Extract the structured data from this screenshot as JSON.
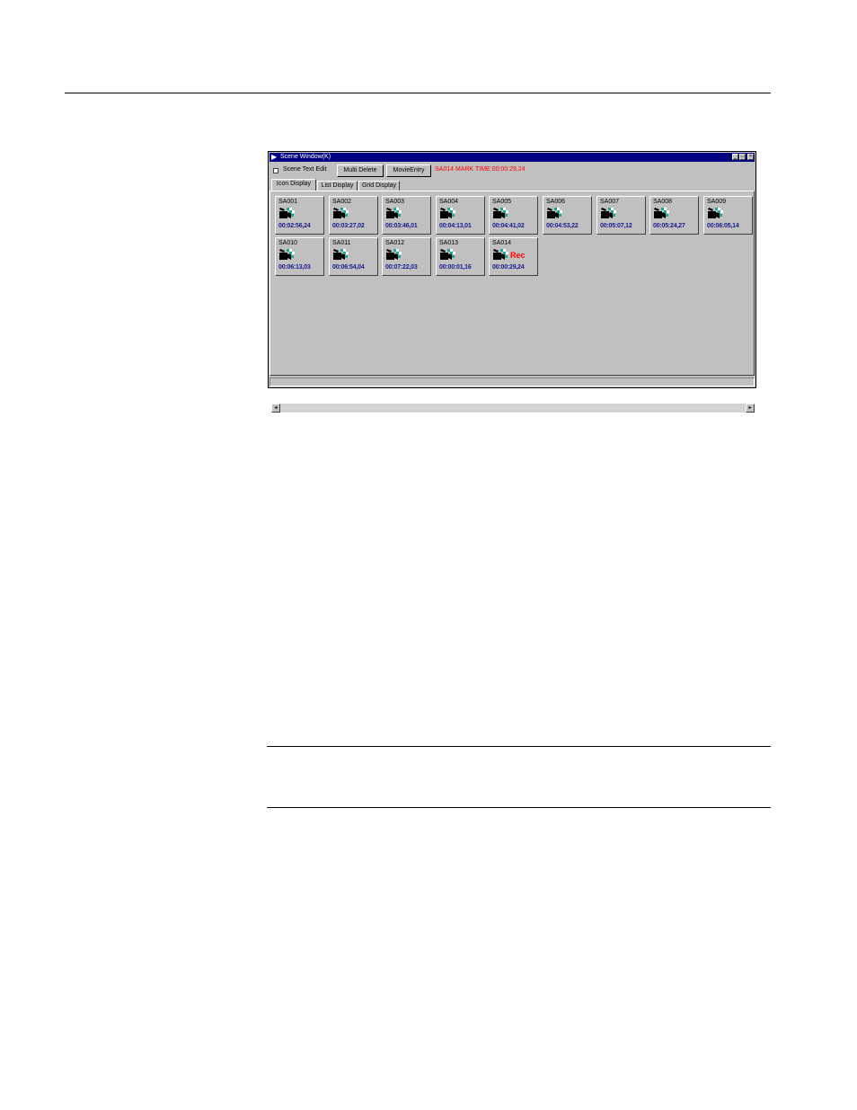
{
  "window": {
    "title": "Scene Window(K)",
    "title_icon": "app-icon",
    "controls": {
      "minimize": "_",
      "maximize": "□",
      "close": "×"
    }
  },
  "toolbar": {
    "scene_text_edit_label": "Scene Text Edit",
    "scene_text_edit_checked": false,
    "multi_delete_label": "Multi Delete",
    "movie_entry_label": "MovieEntry",
    "mark_time": "SA014 MARK TIME:00:00:29,24"
  },
  "tabs": [
    {
      "label": "Icon Display",
      "active": true
    },
    {
      "label": "List Display",
      "active": false
    },
    {
      "label": "Grid Display",
      "active": false
    }
  ],
  "scenes": [
    {
      "name": "SA001",
      "time": "00:02:56,24"
    },
    {
      "name": "SA002",
      "time": "00:03:27,02"
    },
    {
      "name": "SA003",
      "time": "00:03:46,01"
    },
    {
      "name": "SA004",
      "time": "00:04:13,01"
    },
    {
      "name": "SA005",
      "time": "00:04:41,02"
    },
    {
      "name": "SA006",
      "time": "00:04:53,22"
    },
    {
      "name": "SA007",
      "time": "00:05:07,12"
    },
    {
      "name": "SA008",
      "time": "00:05:24,27"
    },
    {
      "name": "SA009",
      "time": "00:06:05,14"
    },
    {
      "name": "SA010",
      "time": "00:06:13,03"
    },
    {
      "name": "SA011",
      "time": "00:06:54,04"
    },
    {
      "name": "SA012",
      "time": "00:07:22,03"
    },
    {
      "name": "SA013",
      "time": "00:00:01,16"
    },
    {
      "name": "SA014",
      "time": "00:00:29,24",
      "recording": true,
      "rec_label": "Rec"
    }
  ],
  "scroll": {
    "left_arrow": "◂",
    "right_arrow": "▸"
  },
  "colors": {
    "titlebar": "#000080",
    "face": "#c0c0c0",
    "time_text": "#1a1a90",
    "alert": "#ff0000",
    "icon_accent": "#1aa89a"
  }
}
